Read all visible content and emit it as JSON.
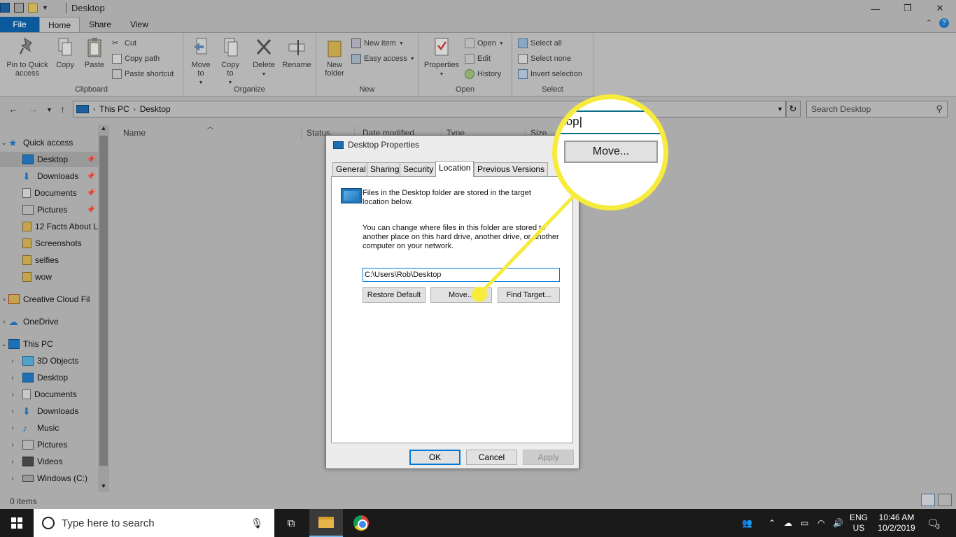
{
  "window": {
    "title": "Desktop",
    "tabs": [
      "File",
      "Home",
      "Share",
      "View"
    ]
  },
  "ribbon": {
    "clipboard": {
      "label": "Clipboard",
      "pin": "Pin to Quick access",
      "copy": "Copy",
      "paste": "Paste",
      "cut": "Cut",
      "copy_path": "Copy path",
      "paste_shortcut": "Paste shortcut"
    },
    "organize": {
      "label": "Organize",
      "move_to": "Move to",
      "copy_to": "Copy to",
      "delete": "Delete",
      "rename": "Rename"
    },
    "new": {
      "label": "New",
      "new_folder": "New folder",
      "new_item": "New item",
      "easy_access": "Easy access"
    },
    "open": {
      "label": "Open",
      "properties": "Properties",
      "open": "Open",
      "edit": "Edit",
      "history": "History"
    },
    "select": {
      "label": "Select",
      "select_all": "Select all",
      "select_none": "Select none",
      "invert": "Invert selection"
    }
  },
  "address": {
    "crumbs": [
      "This PC",
      "Desktop"
    ],
    "search_placeholder": "Search Desktop"
  },
  "columns": [
    "Name",
    "Status",
    "Date modified",
    "Type",
    "Size"
  ],
  "nav": {
    "quick_access": "Quick access",
    "items": [
      {
        "label": "Desktop",
        "pinned": true
      },
      {
        "label": "Downloads",
        "pinned": true
      },
      {
        "label": "Documents",
        "pinned": true
      },
      {
        "label": "Pictures",
        "pinned": true
      },
      {
        "label": "12 Facts About L",
        "pinned": false
      },
      {
        "label": "Screenshots",
        "pinned": false
      },
      {
        "label": "selfies",
        "pinned": false
      },
      {
        "label": "wow",
        "pinned": false
      }
    ],
    "creative_cloud": "Creative Cloud Fil",
    "onedrive": "OneDrive",
    "this_pc": "This PC",
    "pc_items": [
      "3D Objects",
      "Desktop",
      "Documents",
      "Downloads",
      "Music",
      "Pictures",
      "Videos",
      "Windows (C:)"
    ]
  },
  "status": {
    "items": "0 items"
  },
  "dialog": {
    "title": "Desktop Properties",
    "tabs": [
      "General",
      "Sharing",
      "Security",
      "Location",
      "Previous Versions"
    ],
    "info1": "Files in the Desktop folder are stored in the target location below.",
    "info2": "You can change where files in this folder are stored to another place on this hard drive, another drive, or another computer on your network.",
    "path": "C:\\Users\\Rob\\Desktop",
    "restore": "Restore Default",
    "move": "Move...",
    "find": "Find Target...",
    "ok": "OK",
    "cancel": "Cancel",
    "apply": "Apply"
  },
  "callout": {
    "field_text": "top",
    "button": "Move...",
    "color": "#f7eb3c"
  },
  "taskbar": {
    "search": "Type here to search",
    "lang1": "ENG",
    "lang2": "US",
    "time": "10:46 AM",
    "date": "10/2/2019",
    "notifications": "3"
  }
}
